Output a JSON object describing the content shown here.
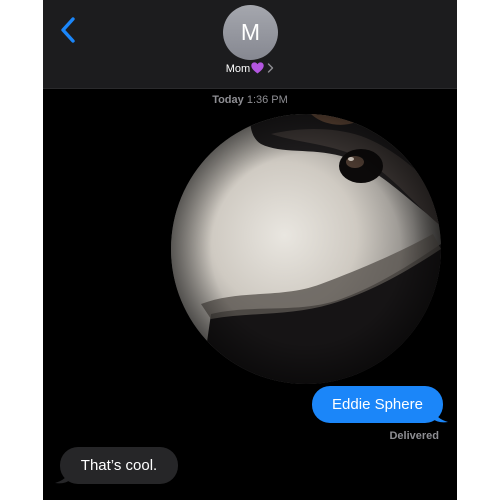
{
  "header": {
    "avatar_initial": "M",
    "contact_name": "Mom",
    "contact_emoji": "purple-heart-icon",
    "back_icon": "chevron-left-icon",
    "details_icon": "chevron-right-icon"
  },
  "timestamp": {
    "day": "Today",
    "time": "1:36 PM"
  },
  "messages": [
    {
      "type": "image",
      "direction": "sent",
      "content": "sphere-photo"
    },
    {
      "type": "text",
      "direction": "sent",
      "text": "Eddie Sphere"
    },
    {
      "type": "text",
      "direction": "received",
      "text": "That’s cool."
    }
  ],
  "delivery_status": "Delivered",
  "colors": {
    "accent": "#1b86f9",
    "received_bubble": "#262628",
    "background": "#000000",
    "header": "#1c1c1e",
    "heart": "#b356e0"
  }
}
